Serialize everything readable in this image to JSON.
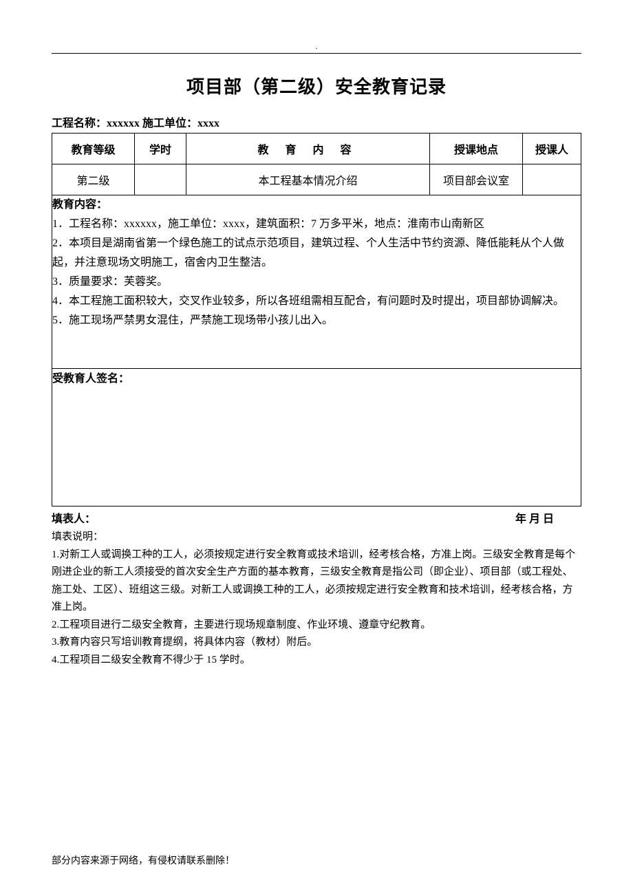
{
  "header_dot": ".",
  "title": "项目部（第二级）安全教育记录",
  "sub_line": "工程名称：xxxxxx 施工单位：xxxx",
  "table": {
    "headers": {
      "level": "教育等级",
      "hours": "学时",
      "content": "教 育 内 容",
      "place": "授课地点",
      "teacher": "授课人"
    },
    "row": {
      "level": "第二级",
      "hours": "",
      "content": "本工程基本情况介绍",
      "place": "项目部会议室",
      "teacher": ""
    }
  },
  "edu": {
    "heading": "教育内容：",
    "items": [
      "1．工程名称：xxxxxx，施工单位：xxxx，建筑面积：7 万多平米，地点：淮南市山南新区",
      "2．本项目是湖南省第一个绿色施工的试点示范项目，建筑过程、个人生活中节约资源、降低能耗从个人做起，并注意现场文明施工，宿舍内卫生整洁。",
      "3．质量要求：芙蓉奖。",
      "4．本工程施工面积较大，交叉作业较多，所以各班组需相互配合，有问题时及时提出，项目部协调解决。",
      "5．施工现场严禁男女混住，严禁施工现场带小孩儿出入。"
    ]
  },
  "signature_heading": "受教育人签名：",
  "filler": {
    "left": "填表人：",
    "right": "年    月    日"
  },
  "notes": {
    "heading": "填表说明：",
    "items": [
      "1.对新工人或调换工种的工人，必须按规定进行安全教育或技术培训，经考核合格，方准上岗。三级安全教育是每个刚进企业的新工人须接受的首次安全生产方面的基本教育，三级安全教育是指公司（即企业）、项目部（或工程处、施工处、工区）、班组这三级。对新工人或调换工种的工人，必须按规定进行安全教育和技术培训，经考核合格，方准上岗。",
      "2.工程项目进行二级安全教育，主要进行现场规章制度、作业环境、遵章守纪教育。",
      "3.教育内容只写培训教育提纲，将具体内容（教材）附后。",
      "4.工程项目二级安全教育不得少于 15 学时。"
    ]
  },
  "footer": "部分内容来源于网络，有侵权请联系删除！"
}
